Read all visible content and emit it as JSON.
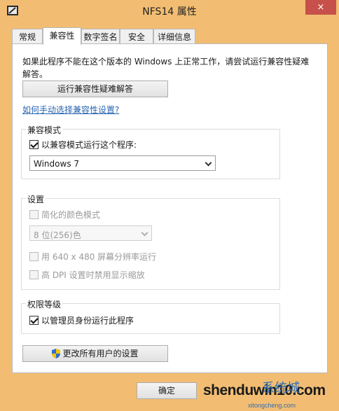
{
  "window": {
    "title": "NFS14 属性",
    "close_glyph": "×"
  },
  "tabs": [
    "常规",
    "兼容性",
    "数字签名",
    "安全",
    "详细信息"
  ],
  "intro_text": "如果此程序不能在这个版本的 Windows 上正常工作，请尝试运行兼容性疑难解答。",
  "troubleshooter_button": "运行兼容性疑难解答",
  "manual_link": "如何手动选择兼容性设置?",
  "compat_mode": {
    "group_title": "兼容模式",
    "checkbox_label": "以兼容模式运行这个程序:",
    "checked": true,
    "selected_os": "Windows 7"
  },
  "settings": {
    "group_title": "设置",
    "reduced_color_label": "简化的颜色模式",
    "color_select_value": "8 位(256)色",
    "resolution_label": "用 640 x 480 屏幕分辨率运行",
    "dpi_label": "高 DPI 设置时禁用显示缩放"
  },
  "privilege": {
    "group_title": "权限等级",
    "admin_label": "以管理员身份运行此程序",
    "checked": true
  },
  "change_all_users_button": "更改所有用户的设置",
  "footer": {
    "ok_button": "确定"
  },
  "watermark": {
    "main": "shenduwin10.com",
    "cn": "系统城",
    "sub": "xitongcheng.com"
  },
  "colors": {
    "titlebar": "#f2bd72",
    "close": "#c7504b",
    "link": "#2764b1",
    "panel": "#ffffff"
  }
}
